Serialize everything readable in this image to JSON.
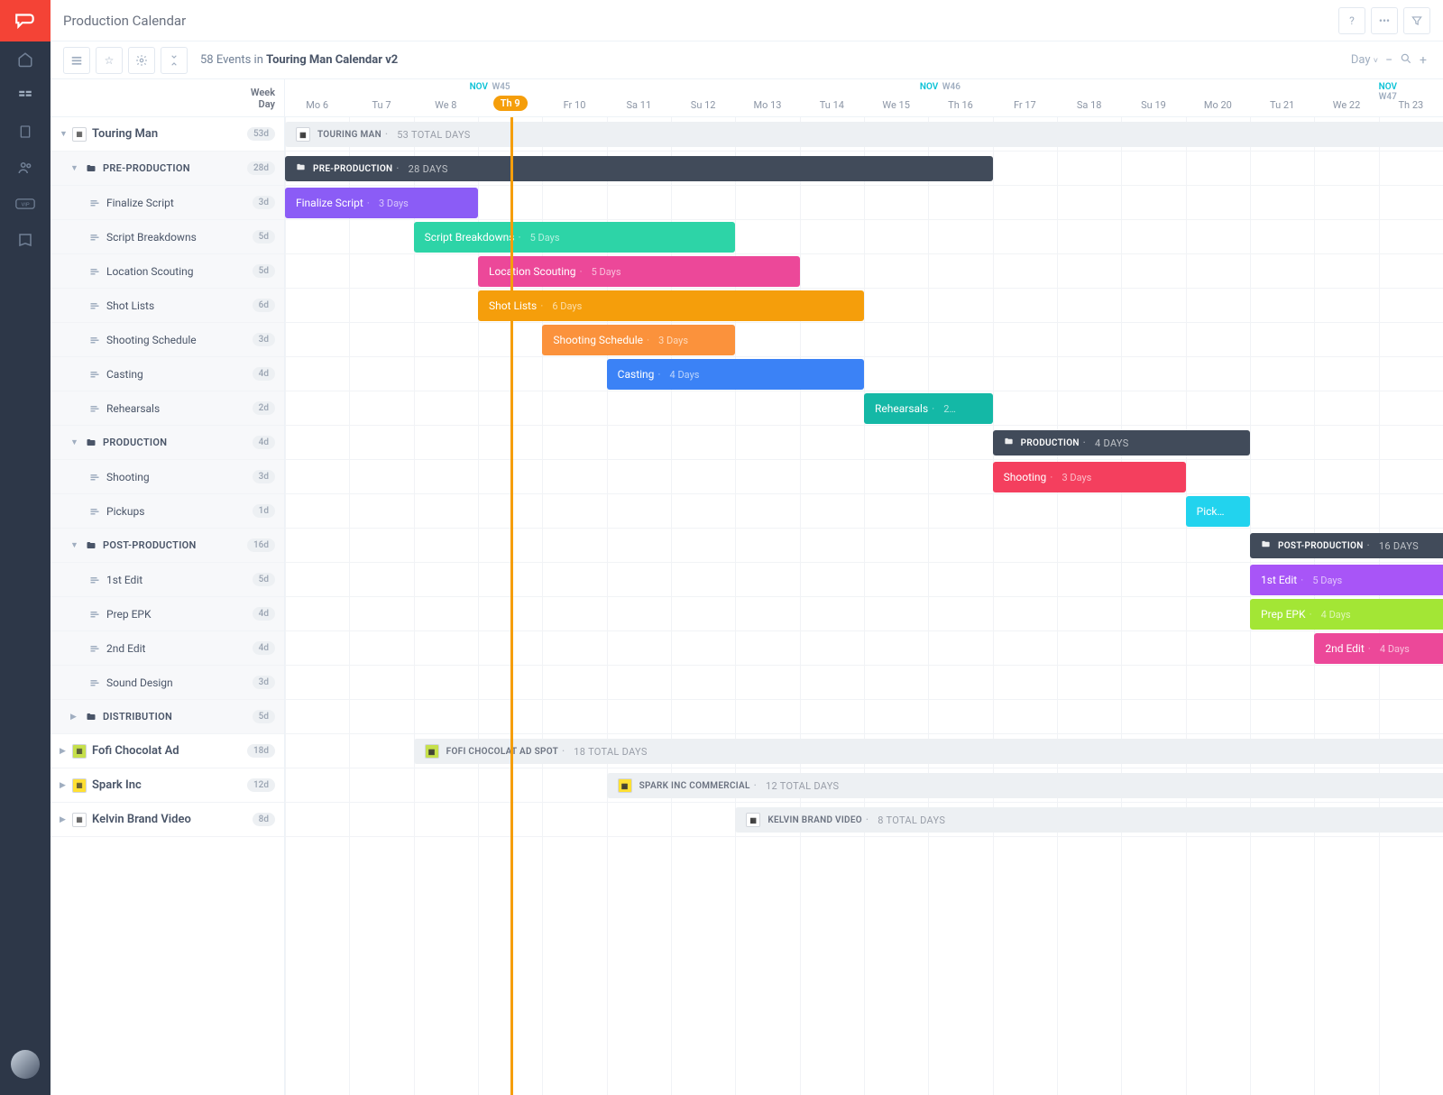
{
  "header": {
    "title": "Production Calendar"
  },
  "toolbar": {
    "event_count": "58",
    "events_in": "Events in",
    "calendar_name": "Touring Man Calendar v2",
    "zoom_label": "Day"
  },
  "date_header": {
    "week_label": "Week",
    "day_label": "Day",
    "weeks": [
      {
        "month": "NOV",
        "wk": "W45",
        "col": 3.5
      },
      {
        "month": "NOV",
        "wk": "W46",
        "col": 10.5
      },
      {
        "month": "NOV",
        "wk": "W47",
        "col": 17.5
      }
    ],
    "days": [
      {
        "label": "Mo 6",
        "col": 0
      },
      {
        "label": "Tu 7",
        "col": 1
      },
      {
        "label": "We 8",
        "col": 2
      },
      {
        "label": "Th 9",
        "col": 3,
        "today": true
      },
      {
        "label": "Fr 10",
        "col": 4
      },
      {
        "label": "Sa 11",
        "col": 5
      },
      {
        "label": "Su 12",
        "col": 6
      },
      {
        "label": "Mo 13",
        "col": 7
      },
      {
        "label": "Tu 14",
        "col": 8
      },
      {
        "label": "We 15",
        "col": 9
      },
      {
        "label": "Th 16",
        "col": 10
      },
      {
        "label": "Fr 17",
        "col": 11
      },
      {
        "label": "Sa 18",
        "col": 12
      },
      {
        "label": "Su 19",
        "col": 13
      },
      {
        "label": "Mo 20",
        "col": 14
      },
      {
        "label": "Tu 21",
        "col": 15
      },
      {
        "label": "We 22",
        "col": 16
      },
      {
        "label": "Th 23",
        "col": 17
      }
    ],
    "today_col": 3,
    "total_cols": 18
  },
  "rows": [
    {
      "type": "group",
      "label": "Touring Man",
      "badge": "53d",
      "chip": "#fff",
      "expanded": true
    },
    {
      "type": "sub",
      "label": "PRE-PRODUCTION",
      "badge": "28d",
      "expanded": true
    },
    {
      "type": "task",
      "label": "Finalize Script",
      "badge": "3d"
    },
    {
      "type": "task",
      "label": "Script Breakdowns",
      "badge": "5d"
    },
    {
      "type": "task",
      "label": "Location Scouting",
      "badge": "5d"
    },
    {
      "type": "task",
      "label": "Shot Lists",
      "badge": "6d"
    },
    {
      "type": "task",
      "label": "Shooting Schedule",
      "badge": "3d"
    },
    {
      "type": "task",
      "label": "Casting",
      "badge": "4d"
    },
    {
      "type": "task",
      "label": "Rehearsals",
      "badge": "2d"
    },
    {
      "type": "sub",
      "label": "PRODUCTION",
      "badge": "4d",
      "expanded": true
    },
    {
      "type": "task",
      "label": "Shooting",
      "badge": "3d"
    },
    {
      "type": "task",
      "label": "Pickups",
      "badge": "1d"
    },
    {
      "type": "sub",
      "label": "POST-PRODUCTION",
      "badge": "16d",
      "expanded": true
    },
    {
      "type": "task",
      "label": "1st Edit",
      "badge": "5d"
    },
    {
      "type": "task",
      "label": "Prep EPK",
      "badge": "4d"
    },
    {
      "type": "task",
      "label": "2nd Edit",
      "badge": "4d"
    },
    {
      "type": "task",
      "label": "Sound Design",
      "badge": "3d"
    },
    {
      "type": "sub",
      "label": "DISTRIBUTION",
      "badge": "5d",
      "expanded": false
    },
    {
      "type": "group",
      "label": "Fofi Chocolat Ad",
      "badge": "18d",
      "chip": "#c6e04b",
      "expanded": false
    },
    {
      "type": "group",
      "label": "Spark Inc",
      "badge": "12d",
      "chip": "#ffe033",
      "expanded": false
    },
    {
      "type": "group",
      "label": "Kelvin Brand Video",
      "badge": "8d",
      "chip": "#fff",
      "expanded": false
    }
  ],
  "bars": [
    {
      "row": 0,
      "type": "header",
      "label": "TOURING MAN",
      "sub": "53 TOTAL DAYS",
      "start": 0,
      "span": 18,
      "extend": true,
      "chip": "#fff"
    },
    {
      "row": 1,
      "type": "phase",
      "label": "PRE-PRODUCTION",
      "sub": "28 DAYS",
      "start": 0,
      "span": 11
    },
    {
      "row": 2,
      "type": "task",
      "label": "Finalize Script",
      "sub": "3 Days",
      "start": 0,
      "span": 3,
      "color": "#8b5cf6"
    },
    {
      "row": 3,
      "type": "task",
      "label": "Script Breakdowns",
      "sub": "5 Days",
      "start": 2,
      "span": 5,
      "color": "#2dd4a7"
    },
    {
      "row": 4,
      "type": "task",
      "label": "Location Scouting",
      "sub": "5 Days",
      "start": 3,
      "span": 5,
      "color": "#ec4899"
    },
    {
      "row": 5,
      "type": "task",
      "label": "Shot Lists",
      "sub": "6 Days",
      "start": 3,
      "span": 6,
      "color": "#f59e0b"
    },
    {
      "row": 6,
      "type": "task",
      "label": "Shooting Schedule",
      "sub": "3 Days",
      "start": 4,
      "span": 3,
      "color": "#fb923c"
    },
    {
      "row": 7,
      "type": "task",
      "label": "Casting",
      "sub": "4 Days",
      "start": 5,
      "span": 4,
      "color": "#3b82f6"
    },
    {
      "row": 8,
      "type": "task",
      "label": "Rehearsals",
      "sub": "2…",
      "start": 9,
      "span": 2,
      "color": "#14b8a6"
    },
    {
      "row": 9,
      "type": "phase",
      "label": "PRODUCTION",
      "sub": "4 DAYS",
      "start": 11,
      "span": 4
    },
    {
      "row": 10,
      "type": "task",
      "label": "Shooting",
      "sub": "3 Days",
      "start": 11,
      "span": 3,
      "color": "#f43f5e"
    },
    {
      "row": 11,
      "type": "task",
      "label": "Pick…",
      "sub": "",
      "start": 14,
      "span": 1,
      "color": "#22d3ee"
    },
    {
      "row": 12,
      "type": "phase",
      "label": "POST-PRODUCTION",
      "sub": "16 DAYS",
      "start": 15,
      "span": 3,
      "extend": true
    },
    {
      "row": 13,
      "type": "task",
      "label": "1st Edit",
      "sub": "5 Days",
      "start": 15,
      "span": 3,
      "color": "#a855f7",
      "extend": true
    },
    {
      "row": 14,
      "type": "task",
      "label": "Prep EPK",
      "sub": "4 Days",
      "start": 15,
      "span": 3,
      "color": "#a3e635",
      "extend": true
    },
    {
      "row": 15,
      "type": "task",
      "label": "2nd Edit",
      "sub": "4 Days",
      "start": 16,
      "span": 2,
      "color": "#ec4899",
      "extend": true
    },
    {
      "row": 18,
      "type": "header",
      "label": "FOFI CHOCOLAT AD SPOT",
      "sub": "18 TOTAL DAYS",
      "start": 2,
      "span": 16,
      "extend": true,
      "chip": "#c6e04b"
    },
    {
      "row": 19,
      "type": "header",
      "label": "SPARK INC COMMERCIAL",
      "sub": "12 TOTAL DAYS",
      "start": 5,
      "span": 13,
      "extend": true,
      "chip": "#ffe033"
    },
    {
      "row": 20,
      "type": "header",
      "label": "KELVIN BRAND VIDEO",
      "sub": "8 TOTAL DAYS",
      "start": 7,
      "span": 11,
      "extend": true,
      "chip": "#fff"
    }
  ]
}
